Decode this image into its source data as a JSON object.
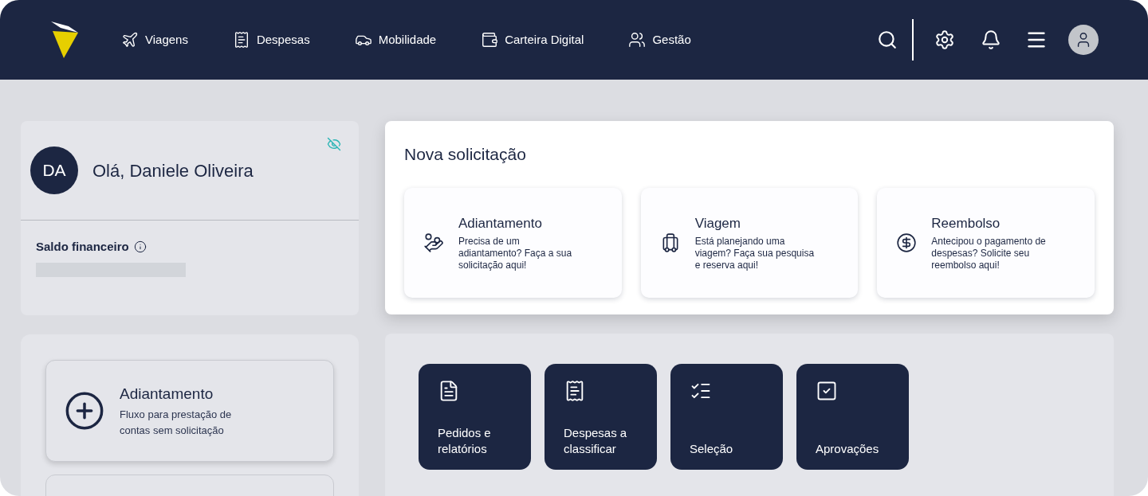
{
  "nav": {
    "items": [
      {
        "label": "Viagens"
      },
      {
        "label": "Despesas"
      },
      {
        "label": "Mobilidade"
      },
      {
        "label": "Carteira Digital"
      },
      {
        "label": "Gestão"
      }
    ]
  },
  "user_card": {
    "initials": "DA",
    "greeting": "Olá, Daniele Oliveira",
    "balance_label": "Saldo financeiro"
  },
  "quick_card": {
    "title": "Adiantamento",
    "description": "Fluxo para prestação de contas sem solicitação"
  },
  "new_request": {
    "title": "Nova solicitação",
    "options": [
      {
        "title": "Adiantamento",
        "description": "Precisa de um adiantamento? Faça a sua solicitação aqui!"
      },
      {
        "title": "Viagem",
        "description": "Está planejando uma viagem? Faça sua pesquisa e reserva aqui!"
      },
      {
        "title": "Reembolso",
        "description": "Antecipou o pagamento de despesas? Solicite seu reembolso aqui!"
      }
    ]
  },
  "shortcuts": [
    {
      "label": "Pedidos e relatórios"
    },
    {
      "label": "Despesas a classificar"
    },
    {
      "label": "Seleção"
    },
    {
      "label": "Aprovações"
    }
  ]
}
